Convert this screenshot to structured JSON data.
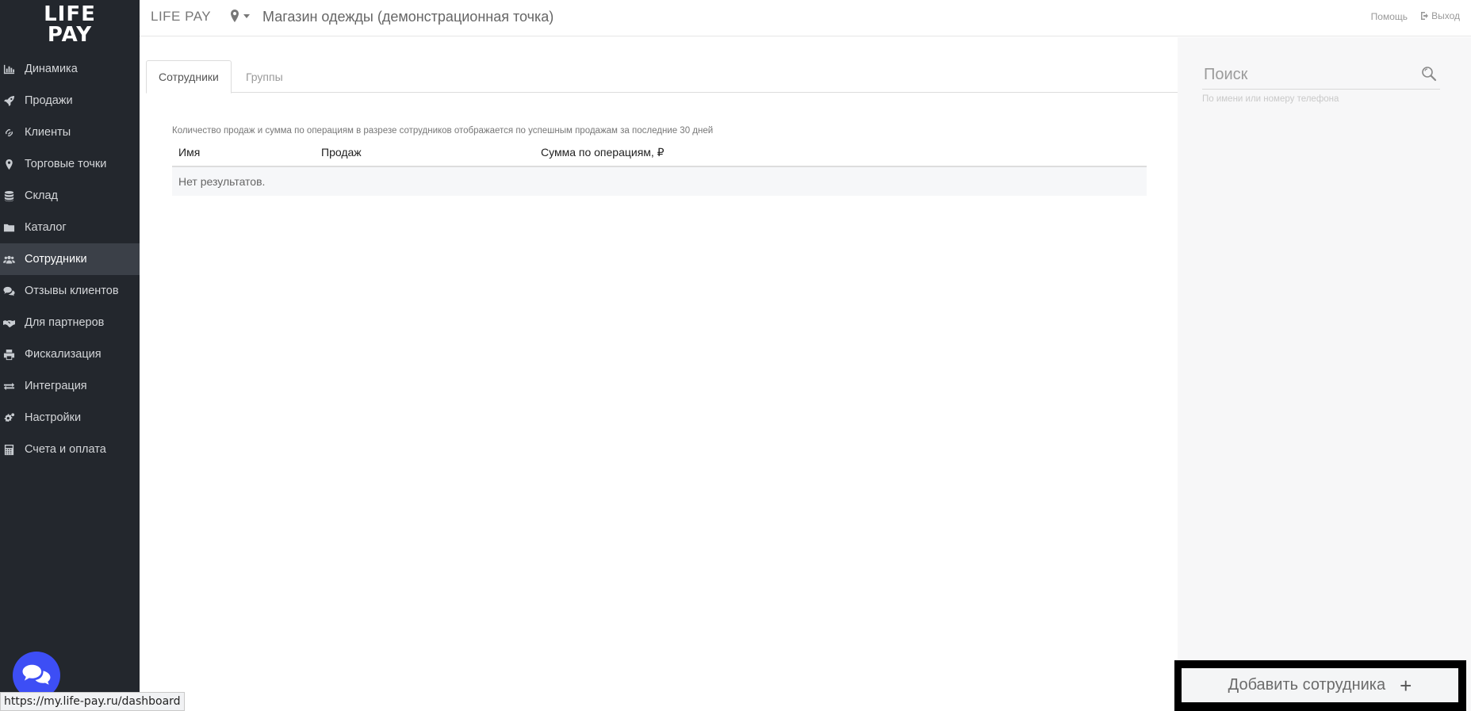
{
  "sidebar": {
    "logo_line1": "LIFE",
    "logo_line2": "PAY",
    "items": [
      {
        "label": "Динамика",
        "icon": "bar-chart-icon"
      },
      {
        "label": "Продажи",
        "icon": "rocket-icon"
      },
      {
        "label": "Клиенты",
        "icon": "link-icon"
      },
      {
        "label": "Торговые точки",
        "icon": "map-marker-icon"
      },
      {
        "label": "Склад",
        "icon": "database-icon"
      },
      {
        "label": "Каталог",
        "icon": "folder-icon"
      },
      {
        "label": "Сотрудники",
        "icon": "users-icon",
        "active": true
      },
      {
        "label": "Отзывы клиентов",
        "icon": "comments-icon"
      },
      {
        "label": "Для партнеров",
        "icon": "handshake-icon"
      },
      {
        "label": "Фискализация",
        "icon": "printer-icon"
      },
      {
        "label": "Интеграция",
        "icon": "exchange-icon"
      },
      {
        "label": "Настройки",
        "icon": "cogs-icon"
      },
      {
        "label": "Счета и оплата",
        "icon": "calculator-icon"
      }
    ]
  },
  "header": {
    "brand": "LIFE PAY",
    "store": "Магазин одежды (демонстрационная точка)",
    "help": "Помощь",
    "logout": "Выход"
  },
  "tabs": [
    {
      "label": "Сотрудники",
      "active": true
    },
    {
      "label": "Группы",
      "active": false
    }
  ],
  "main": {
    "note": "Количество продаж и сумма по операциям в разрезе сотрудников отображается по успешным продажам за последние 30 дней",
    "columns": [
      "Имя",
      "Продаж",
      "Сумма по операциям, ₽"
    ],
    "empty_text": "Нет результатов."
  },
  "search": {
    "placeholder": "Поиск",
    "hint": "По имени или номеру телефона"
  },
  "add_button": {
    "label": "Добавить сотрудника",
    "plus": "+"
  },
  "status_bar": {
    "url": "https://my.life-pay.ru/dashboard"
  },
  "colors": {
    "sidebar_bg": "#23272d",
    "sidebar_active": "#3b4048",
    "chat_button": "#3d4ef5"
  }
}
